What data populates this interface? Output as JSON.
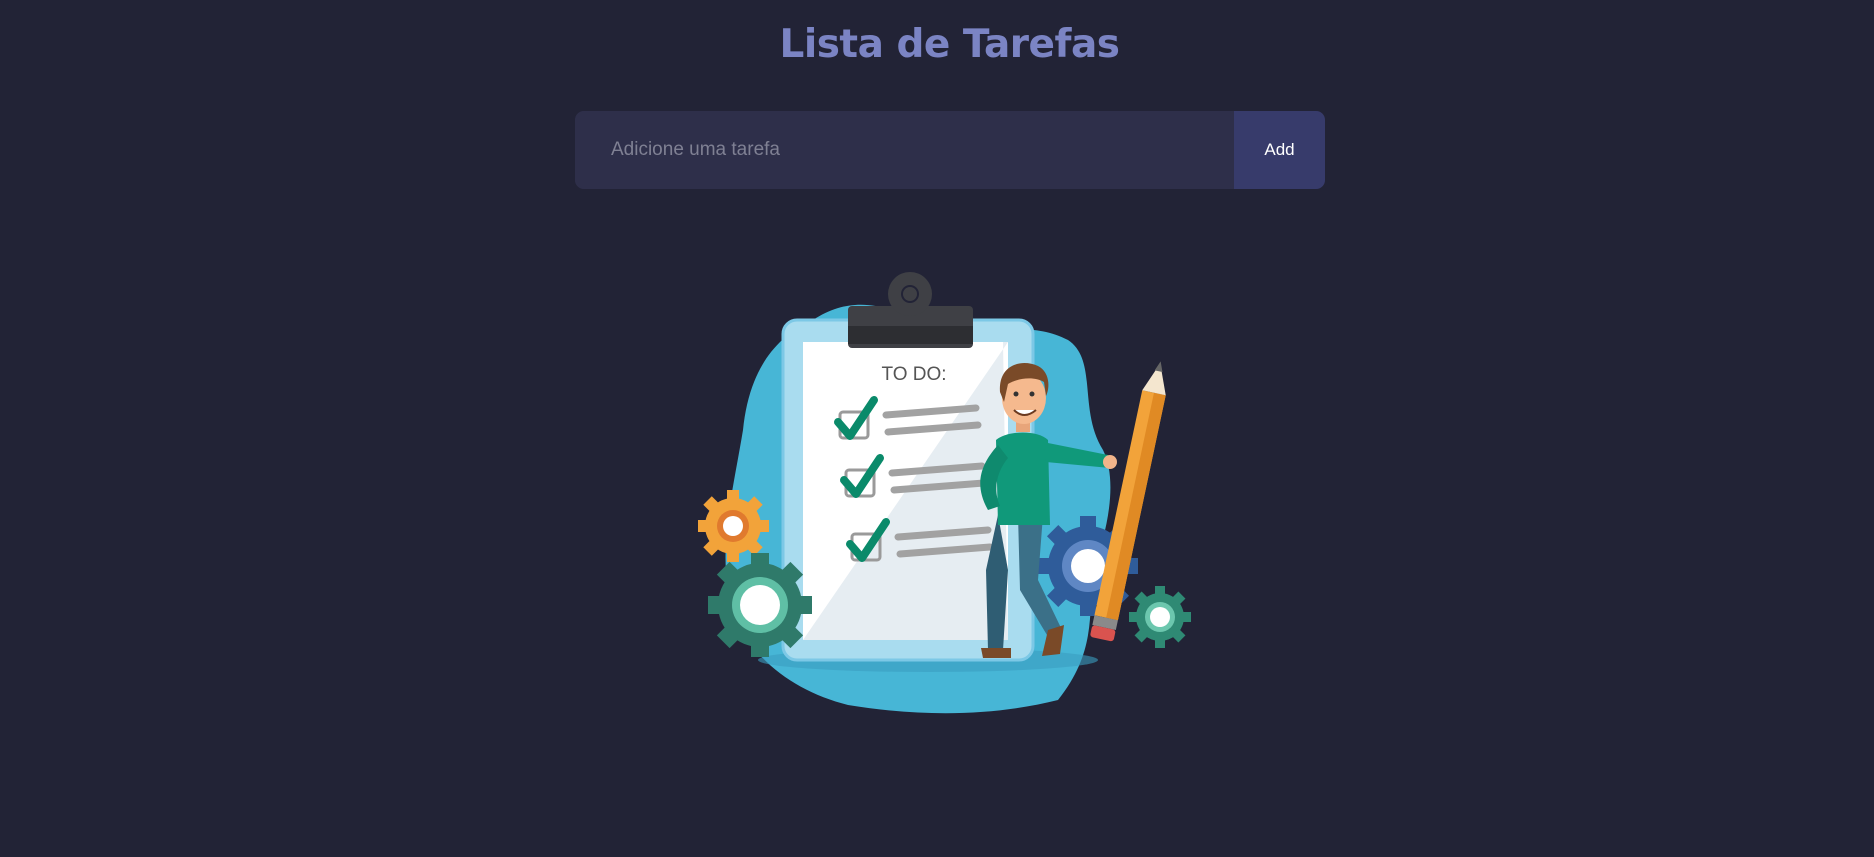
{
  "header": {
    "title": "Lista de Tarefas"
  },
  "form": {
    "input_placeholder": "Adicione uma tarefa",
    "input_value": "",
    "add_label": "Add"
  },
  "illustration": {
    "clipboard_heading": "TO DO:"
  },
  "colors": {
    "background": "#222336",
    "title": "#7b84c4",
    "input_background": "#2e2f4a",
    "button_background": "#373b6b",
    "blob": "#47b6d6",
    "check": "#0a8a6a"
  }
}
